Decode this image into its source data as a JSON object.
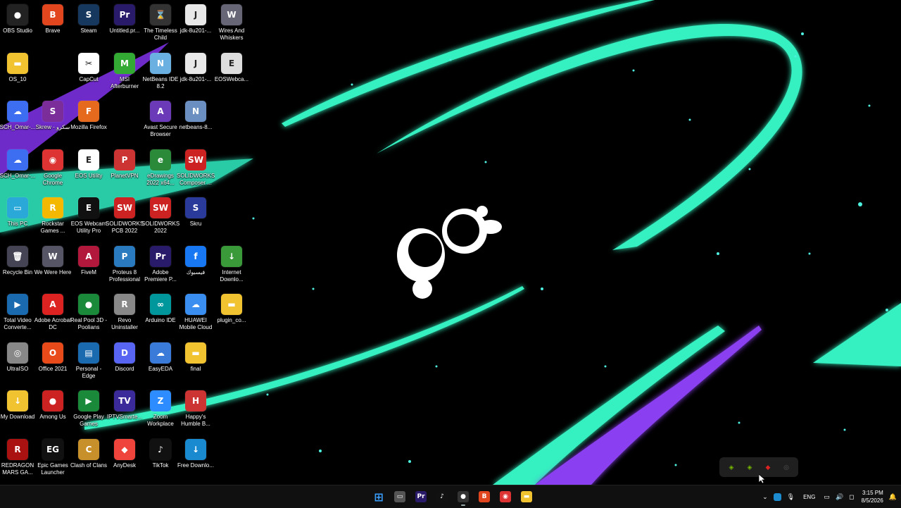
{
  "desktop_icons": [
    {
      "label": "OBS Studio",
      "glyph": "●",
      "color": "#222",
      "col": 0,
      "row": 0
    },
    {
      "label": "Brave",
      "glyph": "B",
      "color": "#e2461f",
      "col": 1,
      "row": 0
    },
    {
      "label": "Steam",
      "glyph": "S",
      "color": "#16385e",
      "col": 2,
      "row": 0
    },
    {
      "label": "Untitled.pr...",
      "glyph": "Pr",
      "color": "#2a1a6a",
      "col": 3,
      "row": 0
    },
    {
      "label": "The Timeless Child",
      "glyph": "⌛",
      "color": "#333",
      "col": 4,
      "row": 0
    },
    {
      "label": "jdk-8u201-...",
      "glyph": "J",
      "color": "#e8e8e8",
      "col": 5,
      "row": 0
    },
    {
      "label": "Wires And Whiskers",
      "glyph": "W",
      "color": "#667",
      "col": 6,
      "row": 0
    },
    {
      "label": "OS_10",
      "glyph": "▬",
      "color": "#f2c330",
      "col": 0,
      "row": 1
    },
    {
      "label": "CapCut",
      "glyph": "✂",
      "color": "#fff",
      "col": 2,
      "row": 1
    },
    {
      "label": "MSI Afterburner",
      "glyph": "M",
      "color": "#3a3",
      "col": 3,
      "row": 1
    },
    {
      "label": "NetBeans IDE 8.2",
      "glyph": "N",
      "color": "#6ab0e0",
      "col": 4,
      "row": 1
    },
    {
      "label": "jdk-8u201-...",
      "glyph": "J",
      "color": "#e8e8e8",
      "col": 5,
      "row": 1
    },
    {
      "label": "EOSWebca...",
      "glyph": "E",
      "color": "#ddd",
      "col": 6,
      "row": 1
    },
    {
      "label": "SCH_Omar-...",
      "glyph": "☁",
      "color": "#3d6df0",
      "col": 0,
      "row": 2
    },
    {
      "label": "Skrew - سكرو",
      "glyph": "S",
      "color": "#7b2d9a",
      "col": 1,
      "row": 2
    },
    {
      "label": "Mozilla Firefox",
      "glyph": "F",
      "color": "#e66a1e",
      "col": 2,
      "row": 2
    },
    {
      "label": "Avast Secure Browser",
      "glyph": "A",
      "color": "#6a3ab8",
      "col": 4,
      "row": 2
    },
    {
      "label": "netbeans-8...",
      "glyph": "N",
      "color": "#6a8fc0",
      "col": 5,
      "row": 2
    },
    {
      "label": "SCH_Omar-...",
      "glyph": "☁",
      "color": "#3d6df0",
      "col": 0,
      "row": 3
    },
    {
      "label": "Google Chrome",
      "glyph": "◉",
      "color": "#d33",
      "col": 1,
      "row": 3
    },
    {
      "label": "EOS Utility",
      "glyph": "E",
      "color": "#fff",
      "col": 2,
      "row": 3
    },
    {
      "label": "PlanetVPN",
      "glyph": "P",
      "color": "#c33",
      "col": 3,
      "row": 3
    },
    {
      "label": "eDrawings 2022 x64...",
      "glyph": "e",
      "color": "#2a8a3a",
      "col": 4,
      "row": 3
    },
    {
      "label": "SOLIDWORKS Composer ...",
      "glyph": "SW",
      "color": "#c22",
      "col": 5,
      "row": 3
    },
    {
      "label": "This PC",
      "glyph": "▭",
      "color": "#2aa8d8",
      "col": 0,
      "row": 4
    },
    {
      "label": "Rockstar Games ...",
      "glyph": "R",
      "color": "#f5b800",
      "col": 1,
      "row": 4
    },
    {
      "label": "EOS Webcam Utility Pro",
      "glyph": "E",
      "color": "#111",
      "col": 2,
      "row": 4
    },
    {
      "label": "SOLIDWORKS PCB 2022",
      "glyph": "SW",
      "color": "#c22",
      "col": 3,
      "row": 4
    },
    {
      "label": "SOLIDWORKS 2022",
      "glyph": "SW",
      "color": "#c22",
      "col": 4,
      "row": 4
    },
    {
      "label": "Skru",
      "glyph": "S",
      "color": "#2a3a9a",
      "col": 5,
      "row": 4
    },
    {
      "label": "Recycle Bin",
      "glyph": "🗑",
      "color": "#445",
      "col": 0,
      "row": 5
    },
    {
      "label": "We Were Here",
      "glyph": "W",
      "color": "#556",
      "col": 1,
      "row": 5
    },
    {
      "label": "FiveM",
      "glyph": "A",
      "color": "#b2183c",
      "col": 2,
      "row": 5
    },
    {
      "label": "Proteus 8 Professional",
      "glyph": "P",
      "color": "#2a7ac0",
      "col": 3,
      "row": 5
    },
    {
      "label": "Adobe Premiere P...",
      "glyph": "Pr",
      "color": "#2a1a6a",
      "col": 4,
      "row": 5
    },
    {
      "label": "فيسبوك",
      "glyph": "f",
      "color": "#1877f2",
      "col": 5,
      "row": 5
    },
    {
      "label": "Internet Downlo...",
      "glyph": "↓",
      "color": "#3a9a3a",
      "col": 6,
      "row": 5
    },
    {
      "label": "Total Video Converte...",
      "glyph": "▶",
      "color": "#1a6ab0",
      "col": 0,
      "row": 6
    },
    {
      "label": "Adobe Acrobat DC",
      "glyph": "A",
      "color": "#d22",
      "col": 1,
      "row": 6
    },
    {
      "label": "Real Pool 3D - Poolians",
      "glyph": "●",
      "color": "#1a8a3a",
      "col": 2,
      "row": 6
    },
    {
      "label": "Revo Uninstaller",
      "glyph": "R",
      "color": "#888",
      "col": 3,
      "row": 6
    },
    {
      "label": "Arduino IDE",
      "glyph": "∞",
      "color": "#00979c",
      "col": 4,
      "row": 6
    },
    {
      "label": "HUAWEI Mobile Cloud",
      "glyph": "☁",
      "color": "#3a8ef0",
      "col": 5,
      "row": 6
    },
    {
      "label": "plugin_co...",
      "glyph": "▬",
      "color": "#f2c330",
      "col": 6,
      "row": 6
    },
    {
      "label": "UltraISO",
      "glyph": "◎",
      "color": "#888",
      "col": 0,
      "row": 7
    },
    {
      "label": "Office 2021",
      "glyph": "O",
      "color": "#e84a1a",
      "col": 1,
      "row": 7
    },
    {
      "label": "Personal - Edge",
      "glyph": "▤",
      "color": "#1a6ab0",
      "col": 2,
      "row": 7
    },
    {
      "label": "Discord",
      "glyph": "D",
      "color": "#5865f2",
      "col": 3,
      "row": 7
    },
    {
      "label": "EasyEDA",
      "glyph": "☁",
      "color": "#3a7ad8",
      "col": 4,
      "row": 7
    },
    {
      "label": "final",
      "glyph": "▬",
      "color": "#f2c330",
      "col": 5,
      "row": 7
    },
    {
      "label": "My Download",
      "glyph": "↓",
      "color": "#f2c330",
      "col": 0,
      "row": 8
    },
    {
      "label": "Among Us",
      "glyph": "●",
      "color": "#c22",
      "col": 1,
      "row": 8
    },
    {
      "label": "Google Play Games",
      "glyph": "▶",
      "color": "#1a8a3a",
      "col": 2,
      "row": 8
    },
    {
      "label": "IPTVSmarte...",
      "glyph": "TV",
      "color": "#3a2a9a",
      "col": 3,
      "row": 8
    },
    {
      "label": "Zoom Workplace",
      "glyph": "Z",
      "color": "#2d8cff",
      "col": 4,
      "row": 8
    },
    {
      "label": "Happy's Humble B...",
      "glyph": "H",
      "color": "#c33",
      "col": 5,
      "row": 8
    },
    {
      "label": "REDRAGON MARS GA...",
      "glyph": "R",
      "color": "#a11",
      "col": 0,
      "row": 9
    },
    {
      "label": "Epic Games Launcher",
      "glyph": "EG",
      "color": "#111",
      "col": 1,
      "row": 9
    },
    {
      "label": "Clash of Clans",
      "glyph": "C",
      "color": "#c8902a",
      "col": 2,
      "row": 9
    },
    {
      "label": "AnyDesk",
      "glyph": "◆",
      "color": "#ef443b",
      "col": 3,
      "row": 9
    },
    {
      "label": "TikTok",
      "glyph": "♪",
      "color": "#111",
      "col": 4,
      "row": 9
    },
    {
      "label": "Free Downlo...",
      "glyph": "↓",
      "color": "#1a8ad0",
      "col": 5,
      "row": 9
    }
  ],
  "tray_popup": [
    {
      "name": "nvidia-tray-icon",
      "glyph": "◈",
      "color": "#76b900"
    },
    {
      "name": "nvidia-tray-icon",
      "glyph": "◈",
      "color": "#76b900"
    },
    {
      "name": "shield-tray-icon",
      "glyph": "◆",
      "color": "#d22"
    },
    {
      "name": "steam-tray-icon",
      "glyph": "◎",
      "color": "#555"
    }
  ],
  "taskbar": {
    "apps": [
      {
        "name": "start-button",
        "glyph": "⊞",
        "color": "#3aa0ff",
        "running": false
      },
      {
        "name": "file-explorer-app",
        "glyph": "▭",
        "color": "#555",
        "running": false
      },
      {
        "name": "premiere-app",
        "glyph": "Pr",
        "color": "#2a1a6a",
        "running": false
      },
      {
        "name": "tiktok-app",
        "glyph": "♪",
        "color": "#111",
        "running": false
      },
      {
        "name": "obs-app",
        "glyph": "●",
        "color": "#333",
        "running": true
      },
      {
        "name": "brave-app",
        "glyph": "B",
        "color": "#e2461f",
        "running": false
      },
      {
        "name": "chrome-app",
        "glyph": "◉",
        "color": "#d33",
        "running": false
      },
      {
        "name": "folder-app",
        "glyph": "▬",
        "color": "#f2c330",
        "running": false
      }
    ],
    "language": "ENG",
    "time": "3:15 PM",
    "date": "8/5/2026"
  }
}
